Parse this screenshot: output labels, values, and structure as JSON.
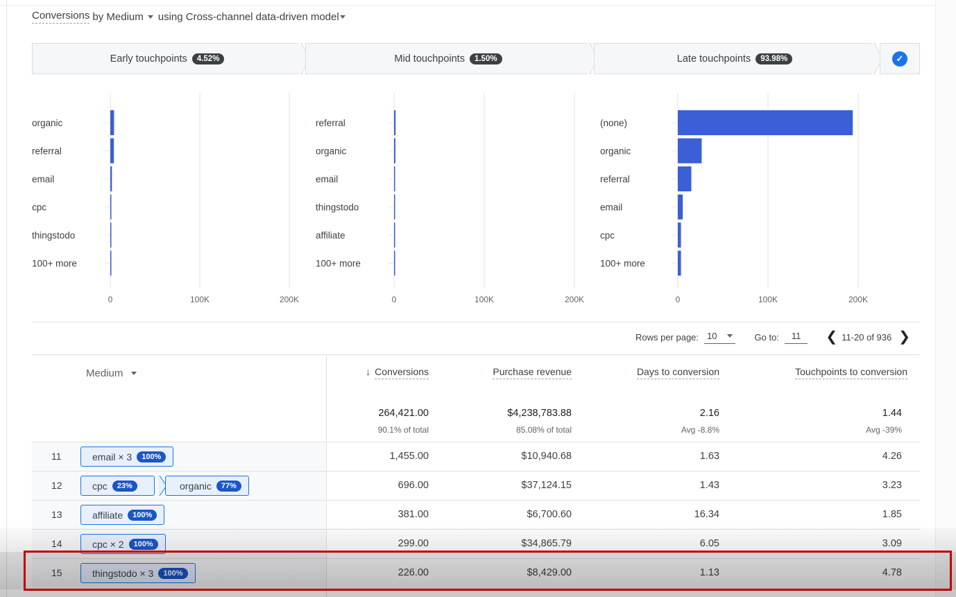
{
  "header": {
    "title_prefix": "Conversions",
    "title_suffix": "by Medium",
    "model_label": "using Cross-channel data-driven model"
  },
  "stages": [
    {
      "label": "Early touchpoints",
      "pct": "4.52%"
    },
    {
      "label": "Mid touchpoints",
      "pct": "1.50%"
    },
    {
      "label": "Late touchpoints",
      "pct": "93.98%"
    }
  ],
  "colors": {
    "bar": "#3b5fd6",
    "accent": "#1a73e8",
    "highlight": "#c00000"
  },
  "chart_data": [
    {
      "type": "bar",
      "orientation": "horizontal",
      "title": "Early touchpoints",
      "categories": [
        "organic",
        "referral",
        "email",
        "cpc",
        "thingstodo",
        "100+ more"
      ],
      "values": [
        4200,
        4000,
        1800,
        300,
        200,
        150
      ],
      "xlim": [
        0,
        200000
      ],
      "ticks": [
        "0",
        "100K",
        "200K"
      ]
    },
    {
      "type": "bar",
      "orientation": "horizontal",
      "title": "Mid touchpoints",
      "categories": [
        "referral",
        "organic",
        "email",
        "thingstodo",
        "affiliate",
        "100+ more"
      ],
      "values": [
        1700,
        1500,
        300,
        200,
        150,
        100
      ],
      "xlim": [
        0,
        200000
      ],
      "ticks": [
        "0",
        "100K",
        "200K"
      ]
    },
    {
      "type": "bar",
      "orientation": "horizontal",
      "title": "Late touchpoints",
      "categories": [
        "(none)",
        "organic",
        "referral",
        "email",
        "cpc",
        "100+ more"
      ],
      "values": [
        194000,
        26500,
        15000,
        5500,
        3500,
        3500
      ],
      "xlim": [
        0,
        200000
      ],
      "ticks": [
        "0",
        "100K",
        "200K"
      ]
    }
  ],
  "pagination": {
    "rows_label": "Rows per page:",
    "rows_value": "10",
    "goto_label": "Go to:",
    "goto_value": "11",
    "range": "11-20 of 936"
  },
  "table": {
    "medium_header": "Medium",
    "columns": [
      "Conversions",
      "Purchase revenue",
      "Days to conversion",
      "Touchpoints to conversion"
    ],
    "sort_arrow": "↓",
    "totals": [
      {
        "value": "264,421.00",
        "sub": "90.1% of total"
      },
      {
        "value": "$4,238,783.88",
        "sub": "85.08% of total"
      },
      {
        "value": "2.16",
        "sub": "Avg -8.8%"
      },
      {
        "value": "1.44",
        "sub": "Avg -39%"
      }
    ],
    "rows": [
      {
        "index": "11",
        "chips": [
          {
            "label": "email × 3",
            "pct": "100%"
          }
        ],
        "values": [
          "1,455.00",
          "$10,940.68",
          "1.63",
          "4.26"
        ]
      },
      {
        "index": "12",
        "chips": [
          {
            "label": "cpc",
            "pct": "23%"
          },
          {
            "label": "organic",
            "pct": "77%"
          }
        ],
        "values": [
          "696.00",
          "$37,124.15",
          "1.43",
          "3.23"
        ]
      },
      {
        "index": "13",
        "chips": [
          {
            "label": "affiliate",
            "pct": "100%"
          }
        ],
        "values": [
          "381.00",
          "$6,700.60",
          "16.34",
          "1.85"
        ]
      },
      {
        "index": "14",
        "chips": [
          {
            "label": "cpc × 2",
            "pct": "100%"
          }
        ],
        "values": [
          "299.00",
          "$34,865.79",
          "6.05",
          "3.09"
        ]
      },
      {
        "index": "15",
        "chips": [
          {
            "label": "thingstodo × 3",
            "pct": "100%"
          }
        ],
        "values": [
          "226.00",
          "$8,429.00",
          "1.13",
          "4.78"
        ]
      }
    ]
  }
}
